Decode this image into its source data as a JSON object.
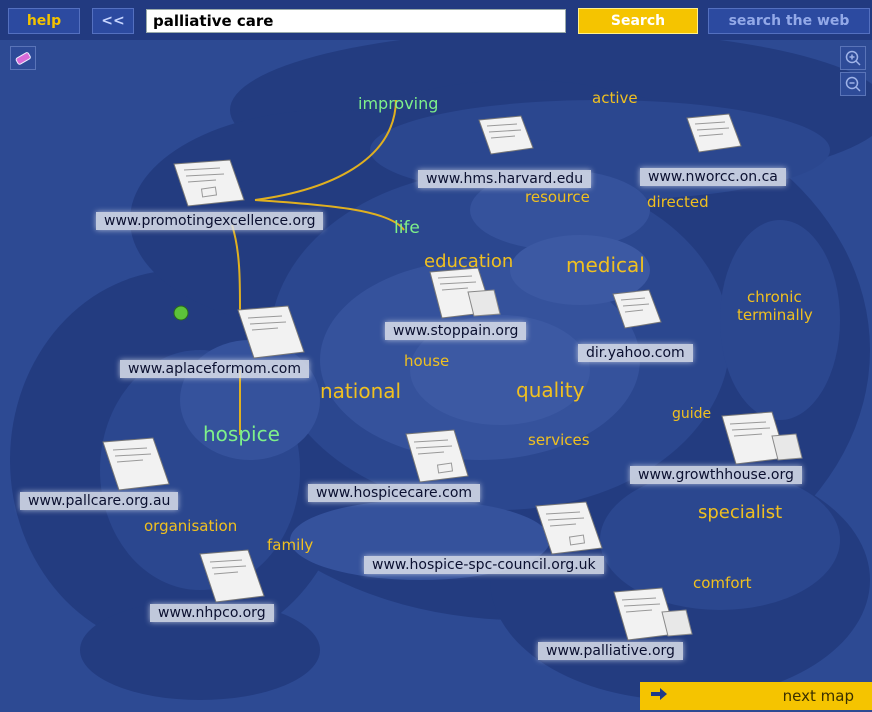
{
  "toolbar": {
    "help_label": "help",
    "back_label": "<<",
    "search_value": "palliative care",
    "search_button_label": "Search",
    "web_button_label": "search the web"
  },
  "map_tools": {
    "eraser_icon": "eraser-icon",
    "zoom_in_icon": "zoom-in-icon",
    "zoom_out_icon": "zoom-out-icon"
  },
  "sites": [
    "www.promotingexcellence.org",
    "www.hms.harvard.edu",
    "www.nworcc.on.ca",
    "www.stoppain.org",
    "dir.yahoo.com",
    "www.aplaceformom.com",
    "www.pallcare.org.au",
    "www.hospicecare.com",
    "www.growthhouse.org",
    "www.hospice-spc-council.org.uk",
    "www.nhpco.org",
    "www.palliative.org"
  ],
  "keywords": [
    "improving",
    "active",
    "resource",
    "directed",
    "life",
    "education",
    "medical",
    "chronic",
    "terminally",
    "house",
    "national",
    "quality",
    "guide",
    "hospice",
    "services",
    "specialist",
    "organisation",
    "family",
    "comfort"
  ],
  "footer": {
    "next_map_label": "next map"
  },
  "colors": {
    "background": "#2d4a93",
    "accent": "#f5c400",
    "keyword": "#f0c020",
    "selected_keyword": "#7ef08a"
  }
}
